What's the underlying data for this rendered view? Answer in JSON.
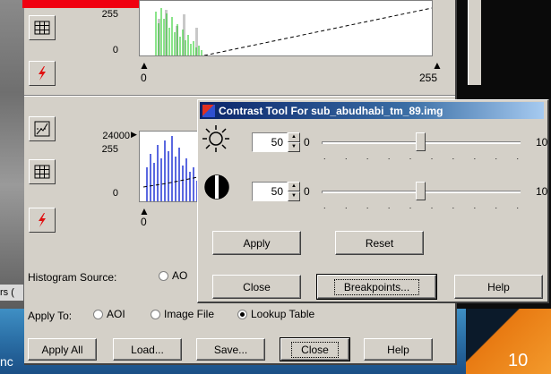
{
  "top_histogram": {
    "y_max_label": "255",
    "y_min_label": "0",
    "x_min_label": "0",
    "x_max_label": "255"
  },
  "bottom_histogram": {
    "y_count_label": "24000",
    "y_max_label": "255",
    "y_min_label": "0",
    "x_min_label": "0"
  },
  "histogram_source": {
    "label": "Histogram Source:",
    "option_aoi": "AO"
  },
  "apply_to": {
    "label": "Apply To:",
    "options": [
      "AOI",
      "Image File",
      "Lookup Table"
    ],
    "selected": "Lookup Table"
  },
  "bottom_buttons": {
    "apply_all": "Apply All",
    "load": "Load...",
    "save": "Save...",
    "close": "Close",
    "help": "Help"
  },
  "contrast_dialog": {
    "title": "Contrast Tool For sub_abudhabi_tm_89.img",
    "brightness": {
      "value": "50",
      "min": "0",
      "max": "10"
    },
    "contrast": {
      "value": "50",
      "min": "0",
      "max": "10"
    },
    "apply": "Apply",
    "reset": "Reset",
    "close": "Close",
    "breakpoints": "Breakpoints...",
    "help": "Help"
  },
  "background": {
    "slide_number": "10",
    "left_fragment_1": "rs (",
    "left_fragment_2": "nc"
  }
}
